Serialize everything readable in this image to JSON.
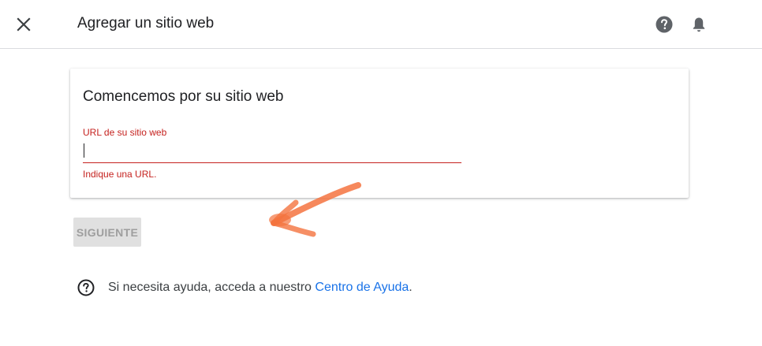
{
  "header": {
    "title": "Agregar un sitio web",
    "icons": [
      "close-icon",
      "help-icon",
      "notifications-icon"
    ]
  },
  "card": {
    "title": "Comencemos por su sitio web",
    "url_field": {
      "label": "URL de su sitio web",
      "value": "",
      "error": "Indique una URL."
    }
  },
  "next_button": {
    "label": "SIGUIENTE",
    "disabled": true
  },
  "help": {
    "text": "Si necesita ayuda, acceda a nuestro ",
    "link": "Centro de Ayuda",
    "suffix": ".",
    "icon": "help-outline-icon"
  },
  "colors": {
    "error": "#c5221f",
    "link": "#1a73e8",
    "annotation_arrow": "#f4733f"
  }
}
